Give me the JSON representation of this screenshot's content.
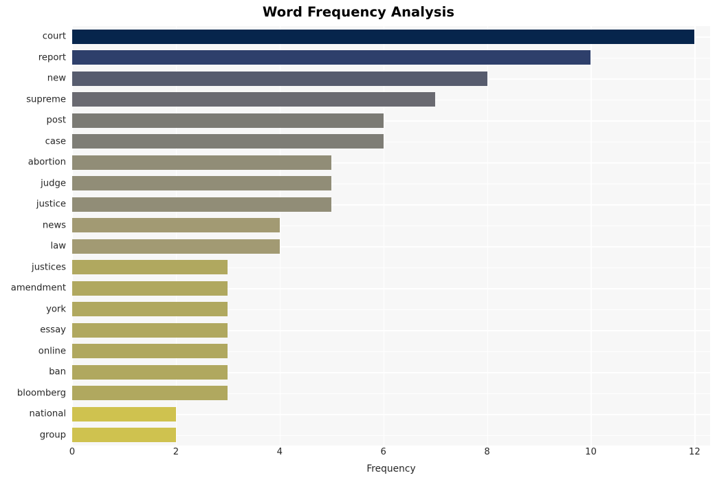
{
  "chart_data": {
    "type": "bar",
    "orientation": "horizontal",
    "title": "Word Frequency Analysis",
    "xlabel": "Frequency",
    "ylabel": "",
    "xlim": [
      0,
      12.3
    ],
    "xticks": [
      0,
      2,
      4,
      6,
      8,
      10,
      12
    ],
    "xticklabels": [
      "0",
      "2",
      "4",
      "6",
      "8",
      "10",
      "12"
    ],
    "grid": true,
    "legend": null,
    "colormap": "cividis",
    "categories": [
      "court",
      "report",
      "new",
      "supreme",
      "post",
      "case",
      "abortion",
      "judge",
      "justice",
      "news",
      "law",
      "justices",
      "amendment",
      "york",
      "essay",
      "online",
      "ban",
      "bloomberg",
      "national",
      "group"
    ],
    "values": [
      12,
      10,
      8,
      7,
      6,
      6,
      5,
      5,
      5,
      4,
      4,
      3,
      3,
      3,
      3,
      3,
      3,
      3,
      2,
      2
    ],
    "bar_colors": [
      "#06254c",
      "#2e3f6b",
      "#575c6e",
      "#6a6a71",
      "#7b7a74",
      "#7e7d76",
      "#918d77",
      "#918d77",
      "#918d77",
      "#a29a73",
      "#a29a73",
      "#b0a85f",
      "#b0a85f",
      "#b0a85f",
      "#b0a85f",
      "#b0a85f",
      "#b0a85f",
      "#b0a85f",
      "#cfc24f",
      "#cfc24f"
    ],
    "colors": {
      "plot_background": "#f7f7f7",
      "figure_background": "#ffffff",
      "gridline": "#ffffff",
      "tick_label": "#262626",
      "title": "#000000"
    }
  }
}
